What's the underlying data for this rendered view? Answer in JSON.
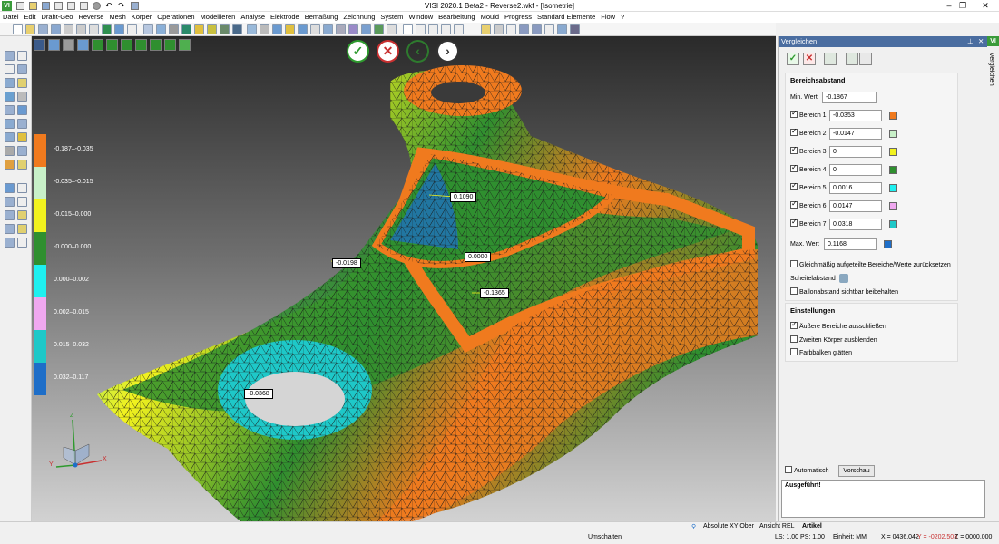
{
  "window": {
    "title": "VISI 2020.1 Beta2 - Reverse2.wkf - [Isometrie]",
    "logo": "VI"
  },
  "menu": [
    "Datei",
    "Edit",
    "Draht-Geo",
    "Reverse",
    "Mesh",
    "Körper",
    "Operationen",
    "Modellieren",
    "Analyse",
    "Elektrode",
    "Bemaßung",
    "Zeichnung",
    "System",
    "Window",
    "Bearbeitung",
    "Mould",
    "Progress",
    "Standard Elemente",
    "Flow",
    "?"
  ],
  "window_controls": {
    "minimize": "–",
    "restore": "❐",
    "close": "✕"
  },
  "viewport": {
    "actions": {
      "accept": "✓",
      "cancel": "✕",
      "back": "‹",
      "forward": "›"
    },
    "legend": [
      {
        "label": "-0.187–-0.035",
        "color": "#f07a1e"
      },
      {
        "label": "-0.035–-0.015",
        "color": "#c8f0c8"
      },
      {
        "label": "-0.015–0.000",
        "color": "#f2f21e"
      },
      {
        "label": "-0.000–0.000",
        "color": "#2f8f2f"
      },
      {
        "label": "0.000–0.002",
        "color": "#1ef0f0"
      },
      {
        "label": "0.002–0.015",
        "color": "#f0a8f0"
      },
      {
        "label": "0.015–0.032",
        "color": "#1ec8c8"
      },
      {
        "label": "0.032–0.117",
        "color": "#1e6ec8"
      }
    ],
    "tags": [
      "0.1090",
      "0.0000",
      "-0.0198",
      "-0.1365",
      "-0.0368"
    ],
    "axis": {
      "x": "X",
      "y": "Y",
      "z": "Z"
    }
  },
  "panel": {
    "title": "Vergleichen",
    "header_icons": {
      "pin": "⊥",
      "close": "✕"
    },
    "bereich": {
      "heading": "Bereichsabstand",
      "min_label": "Min. Wert",
      "min_value": "-0.1867",
      "ranges": [
        {
          "label": "Bereich 1",
          "value": "-0.0353",
          "color": "#f07a1e"
        },
        {
          "label": "Bereich 2",
          "value": "-0.0147",
          "color": "#c8f0c8"
        },
        {
          "label": "Bereich 3",
          "value": "0",
          "color": "#f2f21e"
        },
        {
          "label": "Bereich 4",
          "value": "0",
          "color": "#2f8f2f"
        },
        {
          "label": "Bereich 5",
          "value": "0.0016",
          "color": "#1ef0f0"
        },
        {
          "label": "Bereich 6",
          "value": "0.0147",
          "color": "#f0a8f0"
        },
        {
          "label": "Bereich 7",
          "value": "0.0318",
          "color": "#1ec8c8"
        }
      ],
      "max_label": "Max. Wert",
      "max_value": "0.1168",
      "max_color": "#1e6ec8",
      "reset_label": "Gleichmäßig aufgeteilte Bereiche/Werte zurücksetzen",
      "scheitel_label": "Scheitelabstand",
      "ballon_label": "Ballonabstand sichtbar beibehalten"
    },
    "einstellungen": {
      "heading": "Einstellungen",
      "exclude_label": "Äußere Bereiche ausschließen",
      "hide_label": "Zweiten Körper ausblenden",
      "smooth_label": "Farbbalken glätten"
    },
    "auto_label": "Automatisch",
    "preview_label": "Vorschau",
    "result": "Ausgeführt!"
  },
  "status": {
    "abs": "Absolute XY Ober",
    "ansicht": "Ansicht REL",
    "artikel": "Artikel",
    "umschalten": "Umschalten",
    "ls": "LS: 1.00 PS: 1.00",
    "einheit": "Einheit: MM",
    "x": "X = 0436.042",
    "y": "Y = -0202.503",
    "z": "Z = 0000.000"
  }
}
